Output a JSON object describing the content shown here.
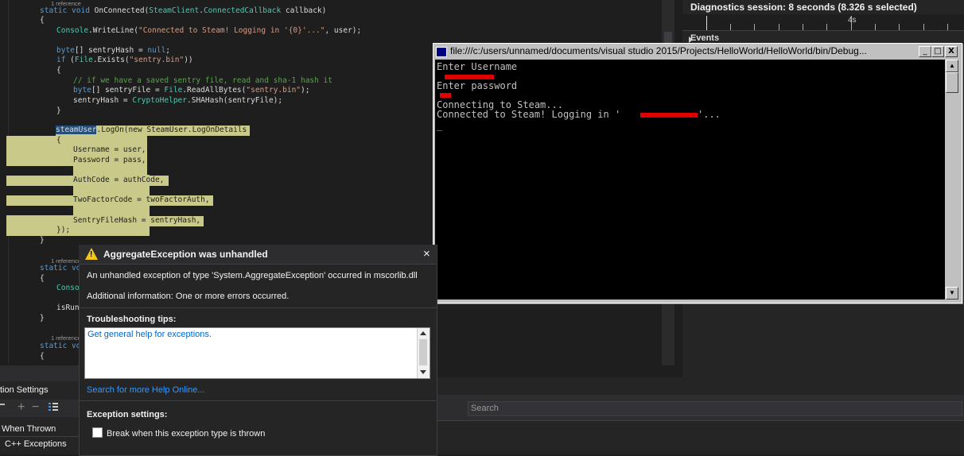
{
  "editor": {
    "ref1": "1 reference",
    "sig1": "static void OnConnected(SteamClient.ConnectedCallback callback)",
    "brace_open": "{",
    "line_writeline": "Console.WriteLine(\"Connected to Steam! Logging in '{0}'...\", user);",
    "line_hash": "byte[] sentryHash = null;",
    "line_if": "if (File.Exists(\"sentry.bin\"))",
    "brace_open2": "{",
    "line_comment": "// if we have a saved sentry file, read and sha-1 hash it",
    "line_readall": "byte[] sentryFile = File.ReadAllBytes(\"sentry.bin\");",
    "line_sha": "sentryHash = CryptoHelper.SHAHash(sentryFile);",
    "brace_close2": "}",
    "line_logon": "steamUser.LogOn(new SteamUser.LogOnDetails",
    "brace_open3": "{",
    "line_user": "Username = user,",
    "line_pass": "Password = pass,",
    "line_auth": "AuthCode = authCode,",
    "line_twofa": "TwoFactorCode = twoFactorAuth,",
    "line_sentry": "SentryFileHash = sentryHash,",
    "line_end": "});",
    "brace_close": "}",
    "ref2": "1 reference",
    "sig2": "static vo",
    "brace_open4": "{",
    "line_conso": "Conso",
    "line_isrun": "isRun",
    "brace_close4": "}",
    "ref3": "1 reference",
    "sig3": "static vo",
    "brace_open5": "{"
  },
  "diagnostics": {
    "title": "Diagnostics session: 8 seconds (8.326 s selected)",
    "tick_label": "4s",
    "events_label": "Events"
  },
  "console": {
    "title": "file:///c:/users/unnamed/documents/visual studio 2015/Projects/HelloWorld/HelloWorld/bin/Debug...",
    "lines": [
      "Enter Username",
      "",
      "Enter password",
      "",
      "Connecting to Steam...",
      "Connected to Steam! Logging in '"
    ],
    "line_tail": "'...",
    "cursor": "_",
    "minimize": "_",
    "maximize": "□",
    "close": "X"
  },
  "exception": {
    "title": "AggregateException was unhandled",
    "close": "×",
    "message": "An unhandled exception of type 'System.AggregateException' occurred in mscorlib.dll",
    "additional": "Additional information: One or more errors occurred.",
    "tips_header": "Troubleshooting tips:",
    "tips_link": "Get general help for exceptions.",
    "search_link": "Search for more Help Online...",
    "settings_header": "Exception settings:",
    "break_label": "Break when this exception type is thrown"
  },
  "bottom": {
    "panel_title": "tion Settings",
    "col_when_thrown": "When Thrown",
    "row_cpp": "C++ Exceptions",
    "search_placeholder": "Search"
  },
  "colors": {
    "accent": "#3399ff",
    "warning": "#f5c518",
    "highlight": "#c9c98a"
  }
}
